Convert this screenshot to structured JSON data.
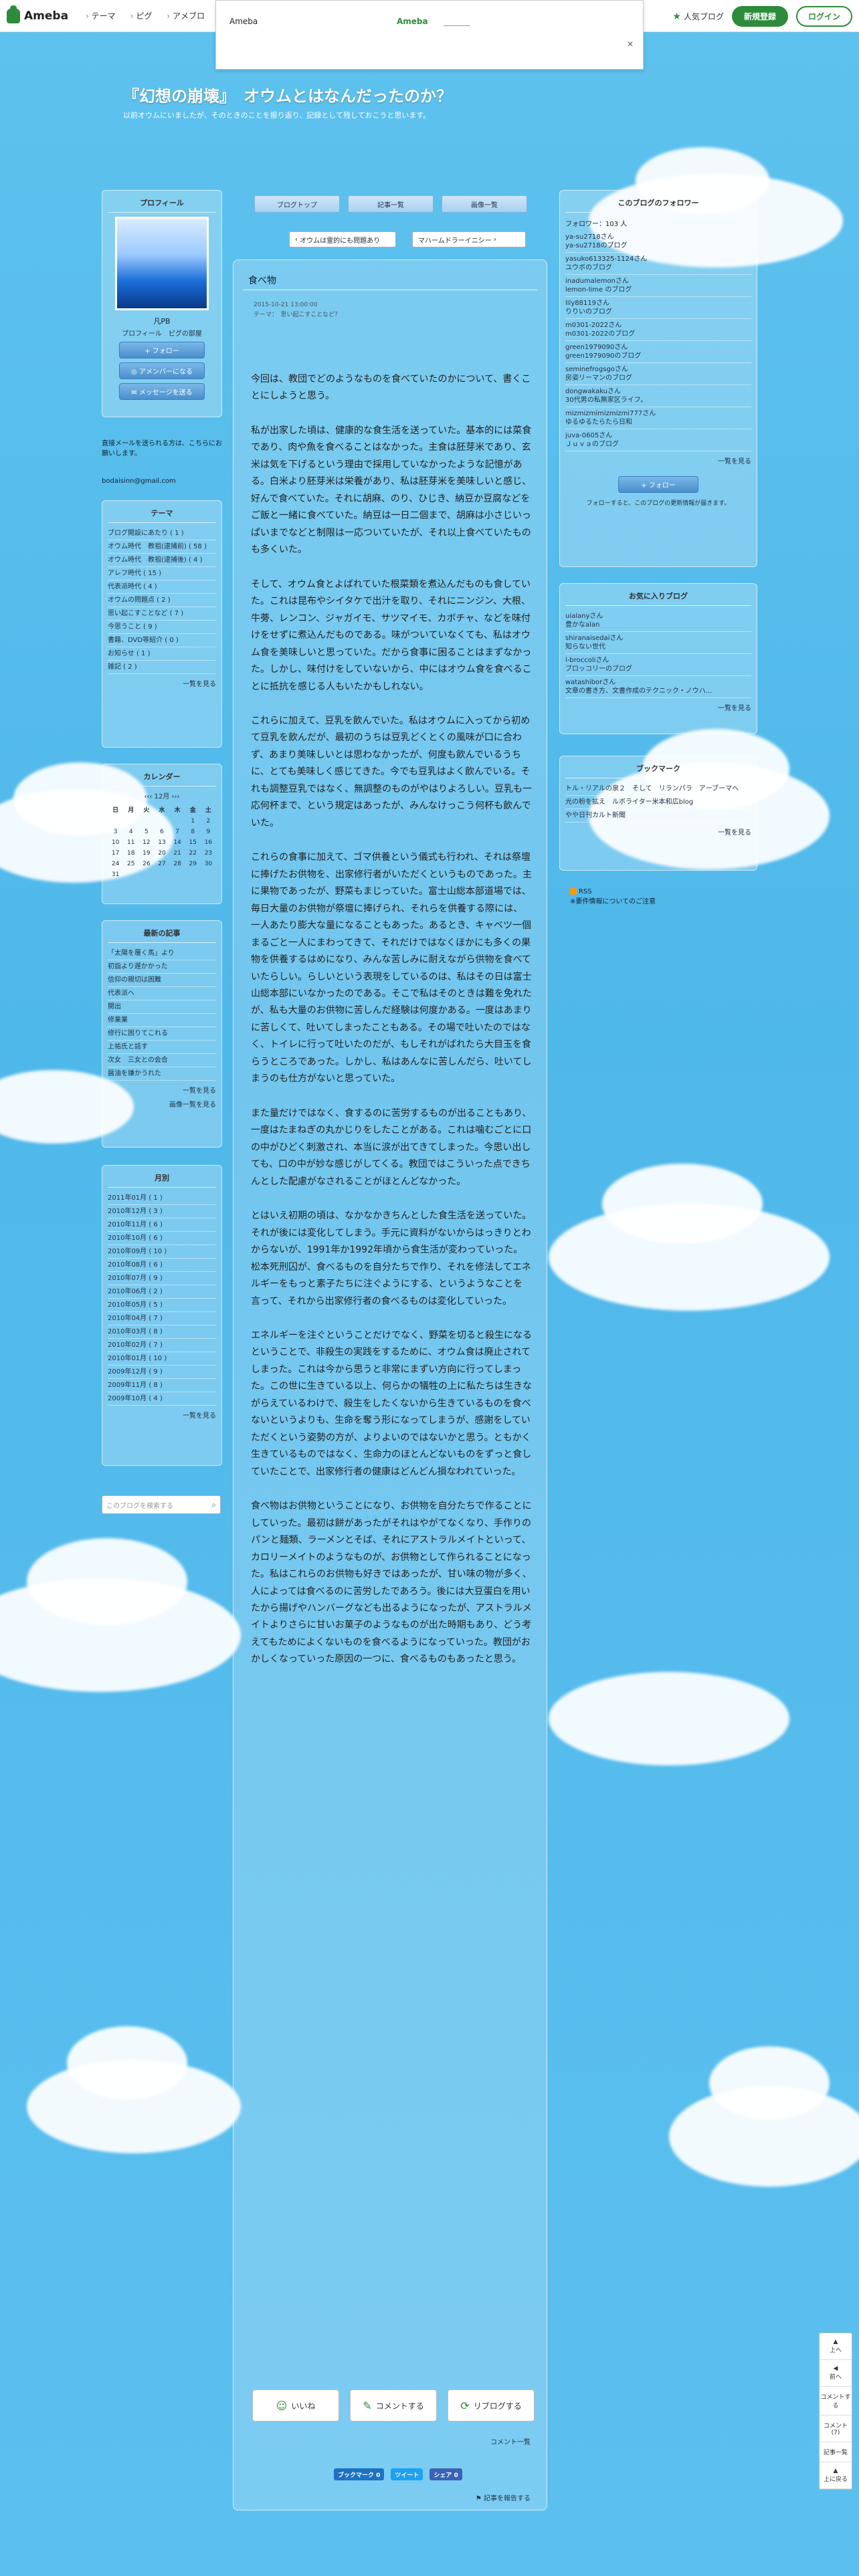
{
  "topbar": {
    "logo": "Ameba",
    "nav": [
      "テーマ",
      "ピグ",
      "アメブロ"
    ],
    "ad_title": "Ameba",
    "ad_link": "Ameba",
    "ad_close": "✕",
    "popular": "人気ブログ",
    "register": "新規登録",
    "login": "ログイン"
  },
  "blog": {
    "title": "『幻想の崩壊』　オウムとはなんだったのか？",
    "desc": "以前オウムにいましたが、そのときのことを振り返り、記録として残しておこうと思います。"
  },
  "tabs": [
    "ブログトップ",
    "記事一覧",
    "画像一覧"
  ],
  "nav": {
    "prev": "オウムは霊的にも問題あり",
    "next": "マハームドラーイニシー"
  },
  "article": {
    "title": "食べ物",
    "date": "2015-10-21 13:00:00",
    "theme": "テーマ：　思い起こすことなど？",
    "paragraphs": [
      "今回は、教団でどのようなものを食べていたのかについて、書くことにしようと思う。",
      "私が出家した頃は、健康的な食生活を送っていた。基本的には菜食であり、肉や魚を食べることはなかった。主食は胚芽米であり、玄米は気を下げるという理由で採用していなかったような記憶がある。白米より胚芽米は栄養があり、私は胚芽米を美味しいと感じ、好んで食べていた。それに胡麻、のり、ひじき、納豆か豆腐などをご飯と一緒に食べていた。納豆は一日二個まで、胡麻は小さじいっぱいまでなどと制限は一応ついていたが、それ以上食べていたものも多くいた。",
      "そして、オウム食とよばれていた根菜類を煮込んだものも食していた。これは昆布やシイタケで出汁を取り、それにニンジン、大根、牛蒡、レンコン、ジャガイモ、サツマイモ、カボチャ、などを味付けをせずに煮込んだものである。味がついていなくても、私はオウム食を美味しいと思っていた。だから食事に困ることはまずなかった。しかし、味付けをしていないから、中にはオウム食を食べることに抵抗を感じる人もいたかもしれない。",
      "これらに加えて、豆乳を飲んでいた。私はオウムに入ってから初めて豆乳を飲んだが、最初のうちは豆乳どくとくの風味が口に合わず、あまり美味しいとは思わなかったが、何度も飲んでいるうちに、とても美味しく感じてきた。今でも豆乳はよく飲んでいる。それも調整豆乳ではなく、無調整のものがやはりよろしい。豆乳も一応何杯まで、という規定はあったが、みんなけっこう何杯も飲んでいた。",
      "これらの食事に加えて、ゴマ供養という儀式も行われ、それは祭壇に捧げたお供物を、出家修行者がいただくというものであった。主に果物であったが、野菜もまじっていた。富士山総本部道場では、毎日大量のお供物が祭壇に捧げられ、それらを供養する際には、一人あたり膨大な量になることもあった。あるとき、キャベツ一個まるごと一人にまわってきて、それだけではなくほかにも多くの果物を供養するはめになり、みんな苦しみに耐えながら供物を食べていたらしい。らしいという表現をしているのは、私はその日は富士山総本部にいなかったのである。そこで私はそのときは難を免れたが、私も大量のお供物に苦しんだ経験は何度かある。一度はあまりに苦しくて、吐いてしまったこともある。その場で吐いたのではなく、トイレに行って吐いたのだが、もしそれがばれたら大目玉を食らうところであった。しかし、私はあんなに苦しんだら、吐いてしまうのも仕方がないと思っていた。",
      "また量だけではなく、食するのに苦労するものが出ることもあり、一度はたまねぎの丸かじりをしたことがある。これは噛むごとに口の中がひどく刺激され、本当に涙が出てきてしまった。今思い出しても、口の中が妙な感じがしてくる。教団ではこういった点できちんとした配慮がなされることがほとんどなかった。",
      "とはいえ初期の頃は、なかなかきちんとした食生活を送っていた。それが後には変化してしまう。手元に資料がないからはっきりとわからないが、1991年か1992年頃から食生活が変わっていった。松本死刑囚が、食べるものを自分たちで作り、それを修法してエネルギーをもっと素子たちに注ぐようにする、というようなことを言って、それから出家修行者の食べるものは変化していった。",
      "エネルギーを注ぐということだけでなく、野菜を切ると殺生になるということで、非殺生の実践をするために、オウム食は廃止されてしまった。これは今から思うと非常にまずい方向に行ってしまった。この世に生きている以上、何らかの犠牲の上に私たちは生きながらえているわけで、殺生をしたくないから生きているものを食べないというよりも、生命を奪う形になってしまうが、感謝をしていただくという姿勢の方が、よりよいのではないかと思う。ともかく生きているものではなく、生命力のほとんどないものをずっと食していたことで、出家修行者の健康はどんどん損なわれていった。",
      "食べ物はお供物ということになり、お供物を自分たちで作ることにしていった。最初は餅があったがそれはやがてなくなり、手作りのパンと麺類、ラーメンとそば、それにアストラルメイトといって、カロリーメイトのようなものが、お供物として作られることになった。私はこれらのお供物も好きではあったが、甘い味の物が多く、人によっては食べるのに苦労したであろう。後には大豆蛋白を用いたから揚げやハンバーグなども出るようになったが、アストラルメイトよりさらに甘いお菓子のようなものが出た時期もあり、どう考えてもためによくないものを食べるようになっていった。教団がおかしくなっていった原因の一つに、食べるものもあったと思う。"
    ],
    "actions": [
      "いいね",
      "コメントする",
      "リブログする"
    ],
    "comment_list": "コメント一覧",
    "share": [
      "ブックマーク 0",
      "ツイート",
      "シェア 0"
    ],
    "report": "記事を報告する"
  },
  "left": {
    "profile_heading": "プロフィール",
    "name": "凡PB",
    "profile_links": "プロフィール　ピグの部屋",
    "buttons": [
      "フォロー",
      "アメンバーになる",
      "メッセージを送る"
    ],
    "note": "直接メールを送られる方は、こちらにお願いします。",
    "email": "bodaisinn@gmail.com",
    "theme_heading": "テーマ",
    "themes": [
      "ブログ開設にあたり ( 1 )",
      "オウム時代　教祖(逮捕前) ( 58 )",
      "オウム時代　教祖(逮捕後) ( 4 )",
      "アレフ時代 ( 15 )",
      "代表派時代 ( 4 )",
      "オウムの問題点 ( 2 )",
      "思い起こすことなど ( 7 )",
      "今思うこと ( 9 )",
      "書籍、DVD等紹介 ( 0 )",
      "お知らせ ( 1 )",
      "雑記 ( 2 )"
    ],
    "theme_more": "一覧を見る",
    "cal_heading": "カレンダー",
    "cal_month": "12月",
    "cal_days": [
      "日",
      "月",
      "火",
      "水",
      "木",
      "金",
      "土"
    ],
    "cal_rows": [
      [
        "",
        "",
        "",
        "",
        "",
        "1",
        "2"
      ],
      [
        "3",
        "4",
        "5",
        "6",
        "7",
        "8",
        "9"
      ],
      [
        "10",
        "11",
        "12",
        "13",
        "14",
        "15",
        "16"
      ],
      [
        "17",
        "18",
        "19",
        "20",
        "21",
        "22",
        "23"
      ],
      [
        "24",
        "25",
        "26",
        "27",
        "28",
        "29",
        "30"
      ],
      [
        "31",
        "",
        "",
        "",
        "",
        "",
        ""
      ]
    ],
    "recent_heading": "最新の記事",
    "recent": [
      "「太陽を覆く馬」より",
      "初詣より遅かかった",
      "信仰の親切は困難",
      "代表派へ",
      "開出",
      "修業業",
      "修行に困りてこれる",
      "上祐氏と話す",
      "次女　三女との会合",
      "醤油を嫌かうれた"
    ],
    "recent_more": [
      "一覧を見る",
      "画像一覧を見る"
    ],
    "monthly_heading": "月別",
    "monthly": [
      "2011年01月 ( 1 )",
      "2010年12月 ( 3 )",
      "2010年11月 ( 6 )",
      "2010年10月 ( 6 )",
      "2010年09月 ( 10 )",
      "2010年08月 ( 6 )",
      "2010年07月 ( 9 )",
      "2010年06月 ( 2 )",
      "2010年05月 ( 5 )",
      "2010年04月 ( 7 )",
      "2010年03月 ( 8 )",
      "2010年02月 ( 7 )",
      "2010年01月 ( 10 )",
      "2009年12月 ( 9 )",
      "2009年11月 ( 8 )",
      "2009年10月 ( 4 )"
    ],
    "monthly_more": "一覧を見る",
    "search_placeholder": "このブログを検索する"
  },
  "right": {
    "followers_heading": "このブログのフォロワー",
    "followers_count": "フォロワー：103 人",
    "followers": [
      "ya-su2718さん",
      "ya-su2718のブログ",
      "yasuko613325-1124さん",
      "ユウボのブログ",
      "inadumalemonさん",
      "lemon-lime のブログ",
      "lily88119さん",
      "りりいのブログ",
      "m0301-2022さん",
      "m0301-2022のブログ",
      "green1979090さん",
      "green1979090のブログ",
      "seminefrogsgoさん",
      "房姿リーマンのブログ",
      "dongwakakuさん",
      "30代男の私無家区ライフ。",
      "mizmizmimizmizmi777さん",
      "ゆるゆるたらたら日和",
      "juva-0605さん",
      "Ｊｕｖａのブログ"
    ],
    "followers_more": "一覧を見る",
    "follow_button": "フォロー",
    "follow_note": "フォローすると、このブログの更新情報が届きます。",
    "favorites_heading": "お気に入りブログ",
    "favorites": [
      "uialanyさん",
      "豊かなalan",
      "shiranaisedaiさん",
      "知らない世代",
      "l-broccoliさん",
      "ブロッコリーのブログ",
      "watashiborさん",
      "文章の書き方、文書作成のテクニック・ノウハ..."
    ],
    "favorites_more": "一覧を見る",
    "bookmark_heading": "ブックマーク",
    "bookmarks": [
      "トル・リアルの泉２　そして　リランパラ　アーブーマへ",
      "光の粉を拡え　ルボライター米本和広blog",
      "やや日刊カルト新聞"
    ],
    "bookmarks_more": "一覧を見る",
    "rss": "RSS",
    "rss_note": "※要件情報についてのご注意"
  },
  "floatbar": [
    "上へ",
    "前へ",
    "コメントする",
    "コメント(7)",
    "記事一覧",
    "上に戻る"
  ]
}
